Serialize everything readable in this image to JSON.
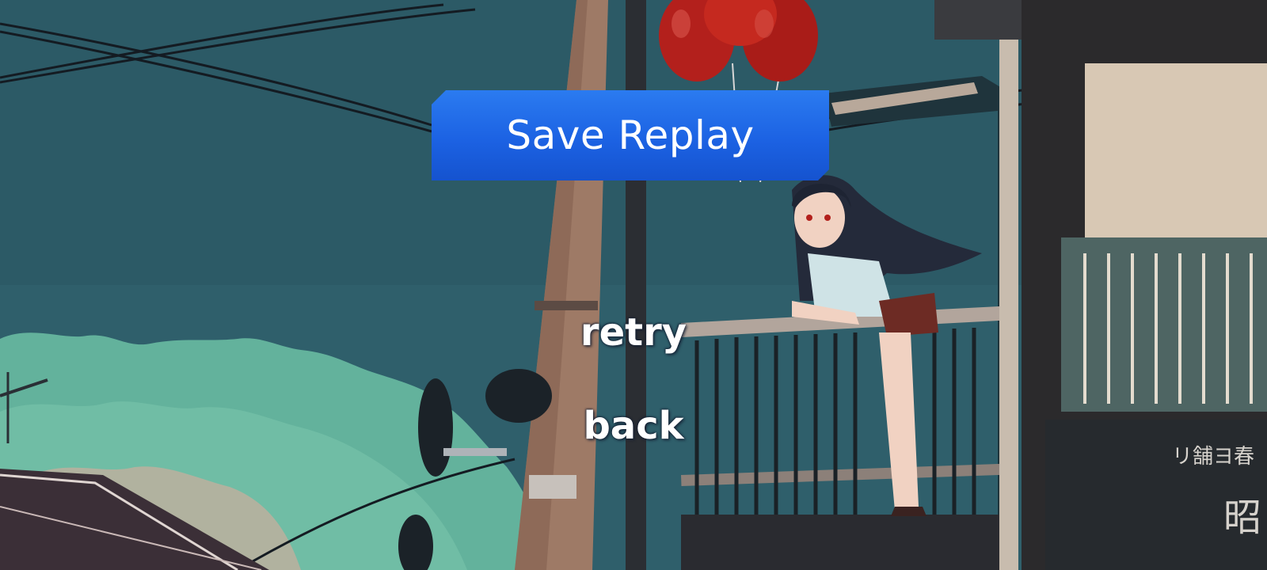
{
  "menu": {
    "save_replay_label": "Save Replay",
    "retry_label": "retry",
    "back_label": "back"
  },
  "sign": {
    "text_top": "リ舗ヨ春",
    "text_side": "昭"
  },
  "colors": {
    "sky": "#2f5f6b",
    "cloud": "#63b29c",
    "button_blue": "#1c62e3",
    "balloon_red": "#b3201c",
    "text_white": "#ffffff"
  },
  "icons": {
    "balloons": "red-balloons-icon"
  }
}
